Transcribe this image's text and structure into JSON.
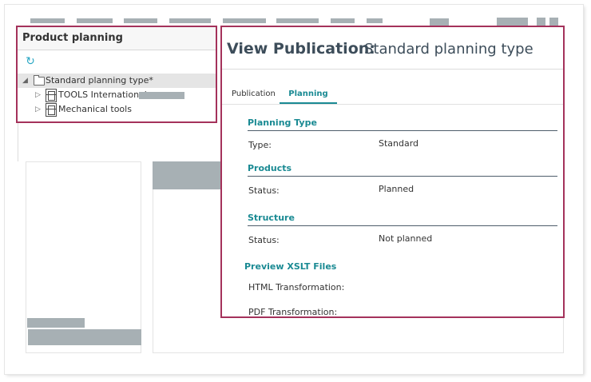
{
  "left_panel": {
    "title": "Product planning",
    "refresh_icon": "refresh-icon",
    "tree": [
      {
        "label": "Standard planning type*",
        "icon": "folder-icon",
        "expanded": true,
        "selected": true
      },
      {
        "label": "TOOLS International",
        "icon": "product-icon",
        "expanded": false
      },
      {
        "label": "Mechanical tools",
        "icon": "product-icon",
        "expanded": false
      }
    ]
  },
  "right_panel": {
    "title_prefix": "View Publication:",
    "title_name": "Standard planning type",
    "tabs": [
      {
        "label": "Publication",
        "active": false
      },
      {
        "label": "Planning",
        "active": true
      }
    ],
    "sections": {
      "planning_type": {
        "heading": "Planning Type",
        "label": "Type:",
        "value": "Standard"
      },
      "products": {
        "heading": "Products",
        "label": "Status:",
        "value": "Planned"
      },
      "structure": {
        "heading": "Structure",
        "label": "Status:",
        "value": "Not planned"
      },
      "xslt": {
        "heading": "Preview XSLT Files",
        "html_label": "HTML Transformation:",
        "pdf_label": "PDF Transformation:"
      }
    }
  },
  "colors": {
    "accent": "#1a8a93",
    "highlight_border": "#a4325b",
    "placeholder": "#a7b0b4"
  }
}
